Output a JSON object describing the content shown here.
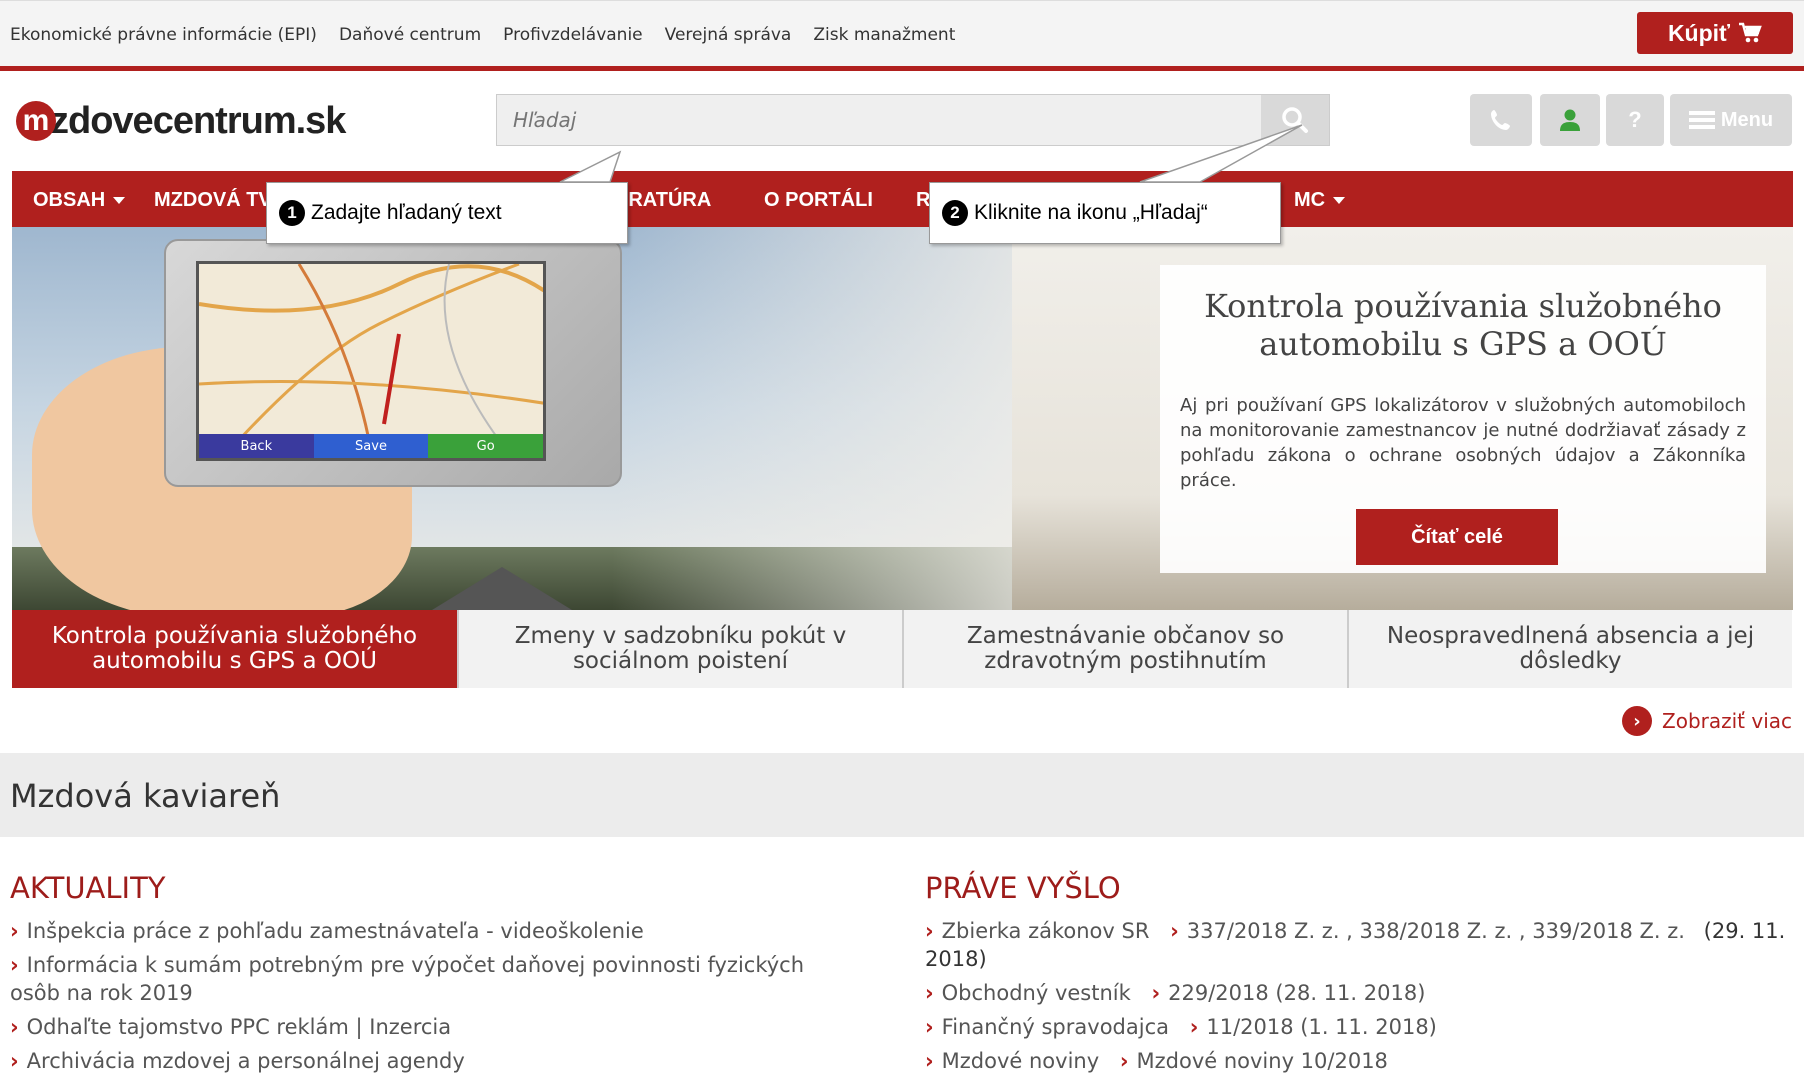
{
  "topbar": {
    "links": [
      "Ekonomické právne informácie (EPI)",
      "Daňové centrum",
      "Profivzdelávanie",
      "Verejná správa",
      "Zisk manažment"
    ],
    "buy_label": "Kúpiť"
  },
  "header": {
    "logo_mark": "m",
    "logo_text": "zdovecentrum.sk",
    "search_placeholder": "Hľadaj",
    "menu_label": "Menu"
  },
  "nav": {
    "items": [
      "OBSAH",
      "MZDOVÁ TV",
      "ERATÚRA",
      "O PORTÁLI",
      "R",
      "MC"
    ]
  },
  "callouts": [
    {
      "number": "1",
      "text": "Zadajte hľadaný text"
    },
    {
      "number": "2",
      "text": "Kliknite na ikonu „Hľadaj“"
    }
  ],
  "hero": {
    "device_buttons": [
      "Back",
      "Save",
      "Go"
    ],
    "promo_title": "Kontrola používania služobného automobilu s GPS a OOÚ",
    "promo_text": "Aj pri používaní GPS lokalizátorov v služobných automobiloch na monitorovanie zamestnancov je nutné dodržiavať zásady z pohľadu zákona o ochrane osobných údajov a Zákonníka práce.",
    "promo_button": "Čítať celé"
  },
  "tabs": [
    "Kontrola používania služobného automobilu s GPS a OOÚ",
    "Zmeny v sadzobníku pokút v sociálnom poistení",
    "Zamestnávanie občanov so zdravotným postihnutím",
    "Neospravedlnená absencia a jej dôsledky"
  ],
  "more_label": "Zobraziť viac",
  "cafe_title": "Mzdová kaviareň",
  "aktuality": {
    "title": "AKTUALITY",
    "items": [
      "Inšpekcia práce z pohľadu zamestnávateľa - videoškolenie",
      "Informácia k sumám potrebným pre výpočet daňovej povinnosti fyzických osôb na rok 2019",
      "Odhaľte tajomstvo PPC reklám | Inzercia",
      "Archivácia mzdovej a personálnej agendy"
    ]
  },
  "prave_vyslo": {
    "title": "PRÁVE VYŠLO",
    "items": [
      {
        "name": "Zbierka zákonov SR",
        "value": "337/2018 Z. z. , 338/2018 Z. z. , 339/2018 Z. z.",
        "date": "(29. 11. 2018)"
      },
      {
        "name": "Obchodný vestník",
        "value": "229/2018 (28. 11. 2018)",
        "date": ""
      },
      {
        "name": "Finančný spravodajca",
        "value": "11/2018 (1. 11. 2018)",
        "date": ""
      },
      {
        "name": "Mzdové noviny",
        "value": "Mzdové noviny 10/2018",
        "date": ""
      }
    ]
  },
  "colors": {
    "brand": "#b0201e"
  }
}
